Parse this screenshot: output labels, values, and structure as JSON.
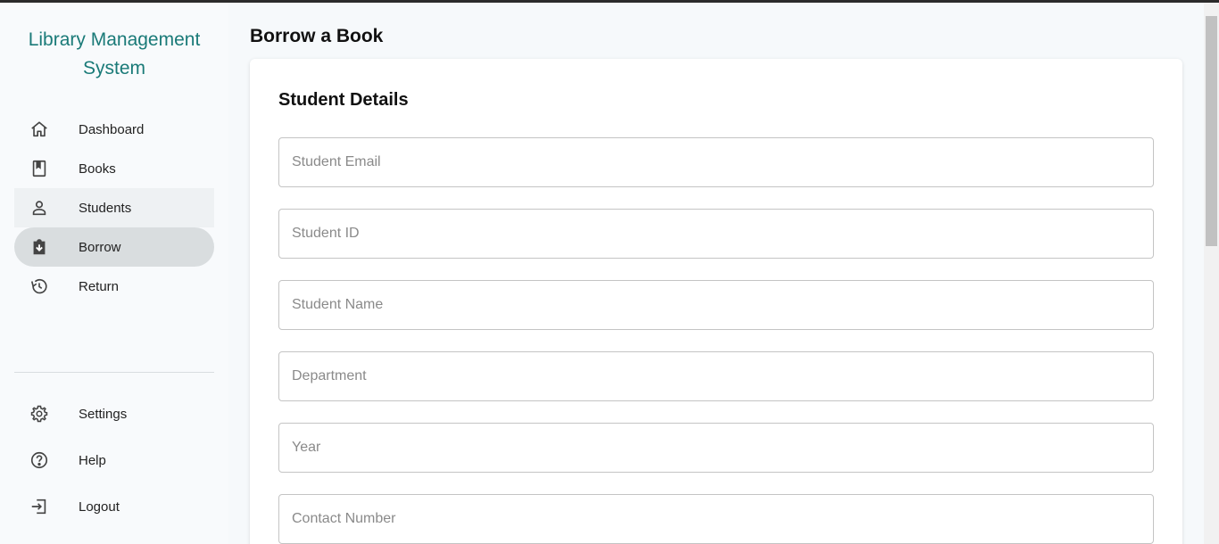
{
  "app": {
    "title_line1": "Library Management",
    "title_line2": "System",
    "accent_color": "#1a7a78"
  },
  "sidebar": {
    "primary_items": [
      {
        "label": "Dashboard",
        "icon": "home-icon"
      },
      {
        "label": "Books",
        "icon": "book-icon"
      },
      {
        "label": "Students",
        "icon": "person-icon"
      },
      {
        "label": "Borrow",
        "icon": "download-clipboard-icon",
        "active": true
      },
      {
        "label": "Return",
        "icon": "history-icon"
      }
    ],
    "secondary_items": [
      {
        "label": "Settings",
        "icon": "gear-icon"
      },
      {
        "label": "Help",
        "icon": "help-circle-icon"
      },
      {
        "label": "Logout",
        "icon": "logout-icon"
      }
    ]
  },
  "main": {
    "page_title": "Borrow a Book",
    "section_title": "Student Details",
    "fields": [
      {
        "placeholder": "Student Email",
        "value": ""
      },
      {
        "placeholder": "Student ID",
        "value": ""
      },
      {
        "placeholder": "Student Name",
        "value": ""
      },
      {
        "placeholder": "Department",
        "value": ""
      },
      {
        "placeholder": "Year",
        "value": ""
      },
      {
        "placeholder": "Contact Number",
        "value": ""
      }
    ]
  }
}
